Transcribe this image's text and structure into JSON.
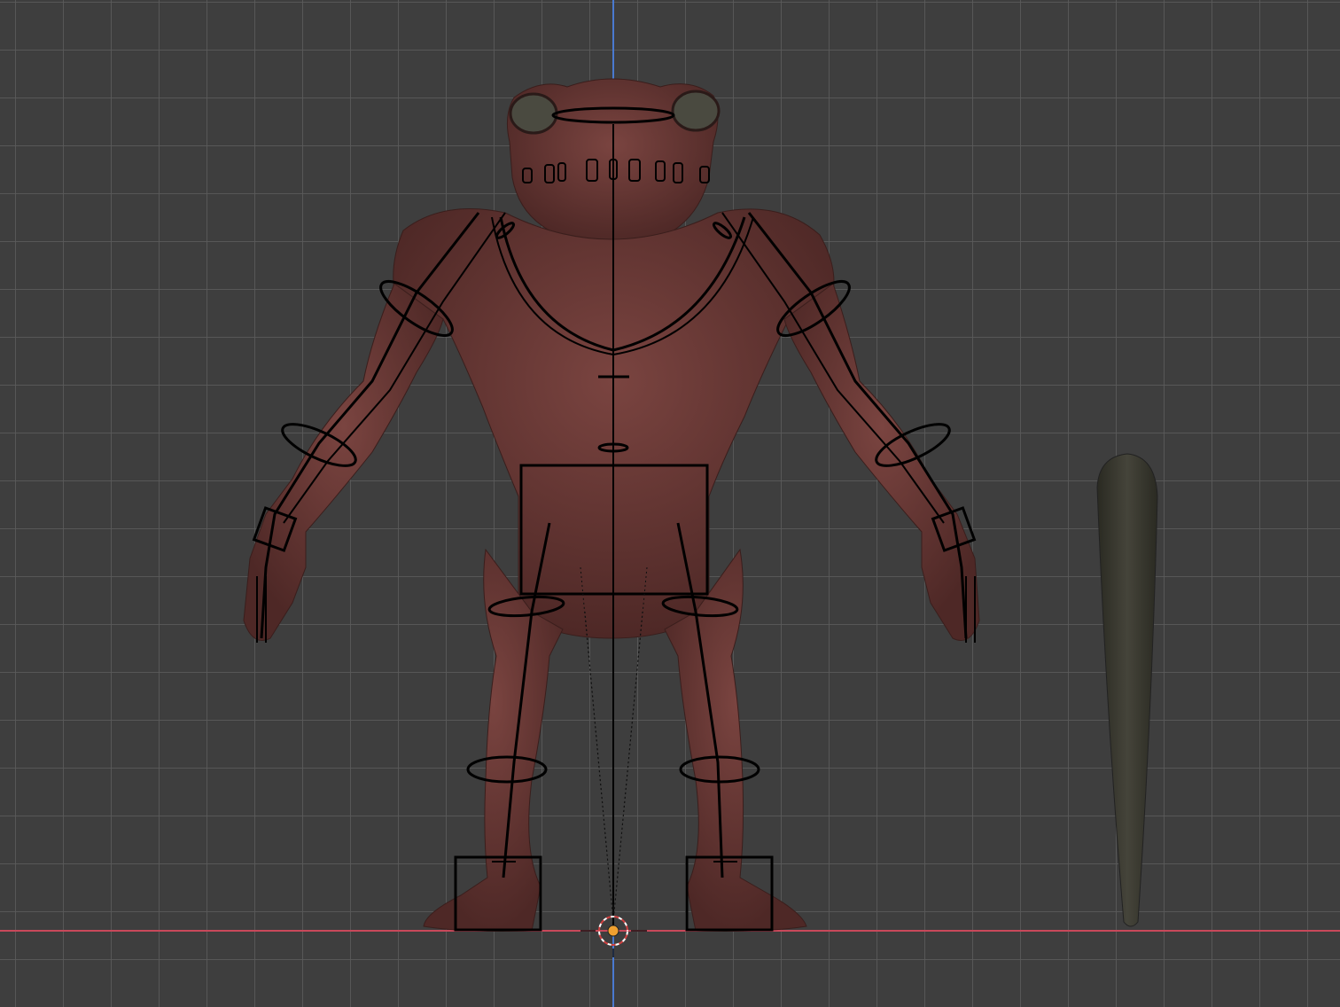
{
  "viewport": {
    "background_color": "#3e3e3e",
    "grid_color": "#5a5a5a",
    "x_axis_color": "#c8485a",
    "z_axis_color": "#4a7ad0",
    "origin_color": "#f0a030",
    "frog_skin_color": "#6e3a36",
    "tail_color": "#3b3a30",
    "armature_color": "#000000"
  },
  "objects": [
    {
      "name": "frog-character-mesh",
      "icon": "mesh-object"
    },
    {
      "name": "armature-rig",
      "icon": "armature-object"
    },
    {
      "name": "tail-mesh",
      "icon": "mesh-object"
    },
    {
      "name": "3d-cursor",
      "icon": "cursor-icon"
    }
  ]
}
